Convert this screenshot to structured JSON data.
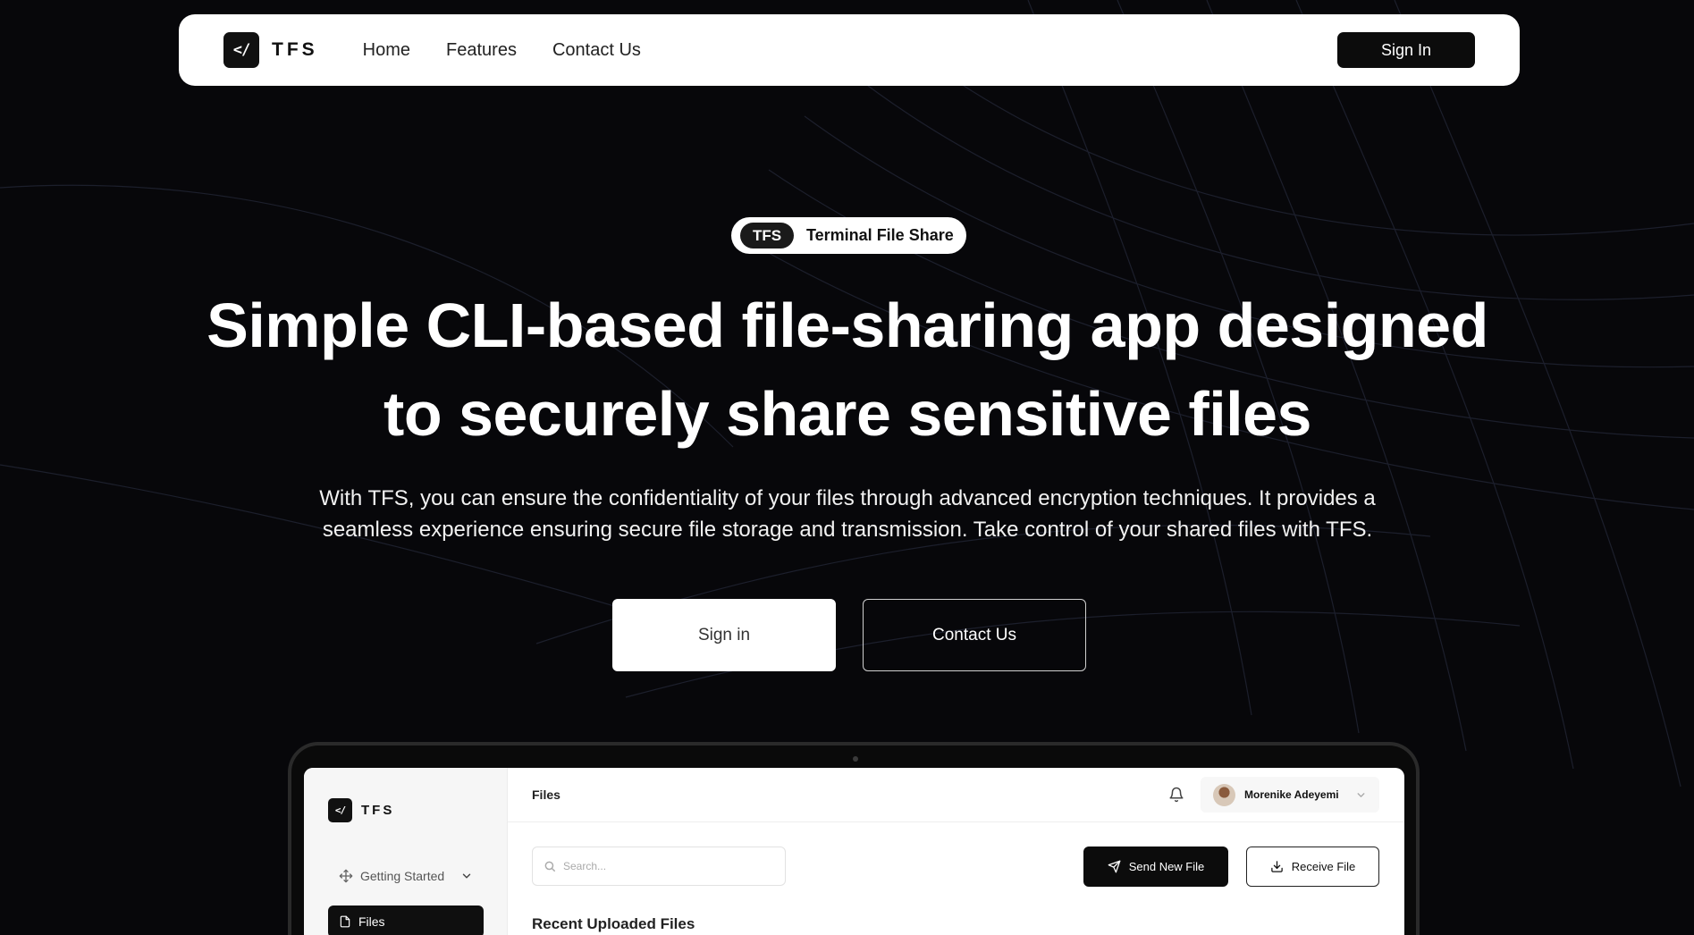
{
  "nav": {
    "logo_glyph": "</",
    "logo_text": "TFS",
    "links": [
      "Home",
      "Features",
      "Contact Us"
    ],
    "signin_label": "Sign In"
  },
  "hero": {
    "pill_badge": "TFS",
    "pill_text": "Terminal File Share",
    "headline_line1": "Simple CLI-based file-sharing app designed",
    "headline_line2": "to securely share sensitive files",
    "subtext_line1": "With TFS, you can ensure the confidentiality of your files through advanced encryption techniques. It provides a",
    "subtext_line2": "seamless experience ensuring secure file storage and transmission. Take control of your shared files with TFS.",
    "signin_button": "Sign in",
    "contact_button": "Contact Us"
  },
  "app_preview": {
    "logo_glyph": "</",
    "logo_text": "TFS",
    "sidebar": {
      "getting_started": "Getting Started",
      "files": "Files"
    },
    "page_title": "Files",
    "user_name": "Morenike Adeyemi",
    "search_placeholder": "Search...",
    "send_button": "Send New File",
    "receive_button": "Receive File",
    "section_title": "Recent Uploaded Files"
  },
  "icons": {
    "bell": "bell-icon",
    "search": "search-icon",
    "send": "send-icon",
    "download": "download-icon",
    "move": "move-icon",
    "file": "file-icon",
    "chevron": "chevron-down-icon"
  },
  "colors": {
    "background": "#07070a",
    "surface": "#ffffff",
    "primary_button": "#0c0c0c"
  }
}
